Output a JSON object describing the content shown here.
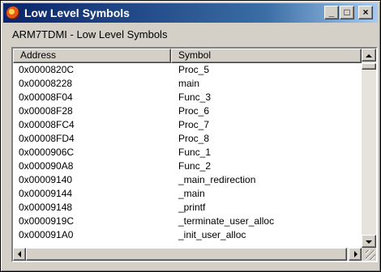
{
  "window": {
    "title": "Low Level Symbols",
    "minimize_label": "_",
    "maximize_label": "□",
    "close_label": "×"
  },
  "subtitle": "ARM7TDMI - Low Level Symbols",
  "list": {
    "columns": [
      "Address",
      "Symbol"
    ],
    "rows": [
      {
        "address": "0x0000820C",
        "symbol": "Proc_5"
      },
      {
        "address": "0x00008228",
        "symbol": "main"
      },
      {
        "address": "0x00008F04",
        "symbol": "Func_3"
      },
      {
        "address": "0x00008F28",
        "symbol": "Proc_6"
      },
      {
        "address": "0x00008FC4",
        "symbol": "Proc_7"
      },
      {
        "address": "0x00008FD4",
        "symbol": "Proc_8"
      },
      {
        "address": "0x0000906C",
        "symbol": "Func_1"
      },
      {
        "address": "0x000090A8",
        "symbol": "Func_2"
      },
      {
        "address": "0x00009140",
        "symbol": "_main_redirection"
      },
      {
        "address": "0x00009144",
        "symbol": "_main"
      },
      {
        "address": "0x00009148",
        "symbol": "_printf"
      },
      {
        "address": "0x0000919C",
        "symbol": "_terminate_user_alloc"
      },
      {
        "address": "0x000091A0",
        "symbol": "_init_user_alloc"
      }
    ]
  },
  "icons": {
    "app": "debugger-app-icon",
    "scroll_up": "up-arrow-icon",
    "scroll_down": "down-arrow-icon",
    "scroll_left": "left-arrow-icon",
    "scroll_right": "right-arrow-icon",
    "resize": "resize-grip-icon"
  },
  "colors": {
    "titlebar_start": "#0a246a",
    "titlebar_end": "#a6caf0",
    "face": "#d4d0c8"
  }
}
